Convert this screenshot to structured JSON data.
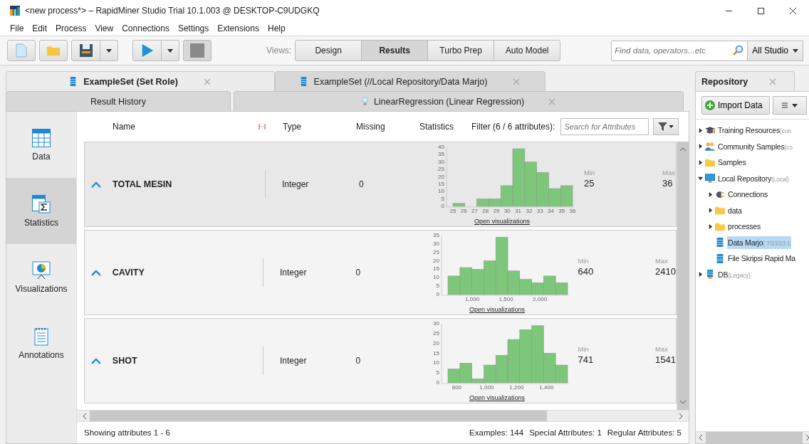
{
  "window": {
    "title": "<new process*> – RapidMiner Studio Trial 10.1.003 @ DESKTOP-C9UDGKQ"
  },
  "menu": [
    {
      "label": "File"
    },
    {
      "label": "Edit"
    },
    {
      "label": "Process"
    },
    {
      "label": "View"
    },
    {
      "label": "Connections"
    },
    {
      "label": "Settings"
    },
    {
      "label": "Extensions"
    },
    {
      "label": "Help"
    }
  ],
  "toolbar": {
    "views_label": "Views:",
    "views": [
      {
        "label": "Design",
        "selected": false
      },
      {
        "label": "Results",
        "selected": true
      },
      {
        "label": "Turbo Prep",
        "selected": false
      },
      {
        "label": "Auto Model",
        "selected": false
      }
    ],
    "search": {
      "placeholder": "Find data, operators...etc"
    },
    "scope": "All Studio"
  },
  "result_tabs": [
    {
      "label": "ExampleSet (Set Role)",
      "selected": true
    },
    {
      "label": "ExampleSet (//Local Repository/Data Marjo)",
      "selected": false
    }
  ],
  "result_tabs_2": [
    {
      "label": "Result History",
      "kind": "plain"
    },
    {
      "label": "LinearRegression (Linear Regression)",
      "kind": "model"
    }
  ],
  "side_nav": [
    {
      "label": "Data",
      "selected": false
    },
    {
      "label": "Statistics",
      "selected": true
    },
    {
      "label": "Visualizations",
      "selected": false
    },
    {
      "label": "Annotations",
      "selected": false
    }
  ],
  "columns": {
    "name": "Name",
    "type": "Type",
    "missing": "Missing",
    "statistics": "Statistics",
    "filter": "Filter (6 / 6 attributes):",
    "search_placeholder": "Search for Attributes"
  },
  "attributes": [
    {
      "name": "TOTAL MESIN",
      "type": "Integer",
      "missing": "0",
      "min_label": "Min",
      "min": "25",
      "max_label": "Max",
      "max": "36",
      "link": "Open visualizations",
      "chart_data": {
        "type": "bar",
        "x": [
          25.55,
          26.65,
          27.75,
          28.85,
          29.95,
          31.05,
          32.15,
          33.25,
          34.35,
          35.45
        ],
        "values": [
          2,
          0,
          5,
          5,
          14,
          39,
          30,
          23,
          12,
          14
        ],
        "xlim": [
          25,
          36
        ],
        "ylim": [
          0,
          40
        ],
        "xticks": [
          25,
          26,
          27,
          28,
          29,
          30,
          31,
          32,
          33,
          34,
          35,
          36
        ],
        "yticks": [
          0,
          5,
          10,
          15,
          20,
          25,
          30,
          35,
          40
        ]
      }
    },
    {
      "name": "CAVITY",
      "type": "Integer",
      "missing": "0",
      "min_label": "Min",
      "min": "640",
      "max_label": "Max",
      "max": "2410",
      "link": "Open visualizations",
      "chart_data": {
        "type": "bar",
        "x": [
          728.5,
          905.5,
          1082.5,
          1259.5,
          1436.5,
          1613.5,
          1790.5,
          1967.5,
          2144.5,
          2321.5
        ],
        "values": [
          11,
          16,
          15,
          20,
          34,
          14,
          9,
          7,
          11,
          7
        ],
        "xlim": [
          640,
          2410
        ],
        "ylim": [
          0,
          35
        ],
        "xticks": [
          {
            "value": 1000,
            "label": "1,000"
          },
          {
            "value": 1500,
            "label": "1,500"
          },
          {
            "value": 2000,
            "label": "2,000"
          }
        ],
        "yticks": [
          0,
          5,
          10,
          15,
          20,
          25,
          30,
          35
        ]
      }
    },
    {
      "name": "SHOT",
      "type": "Integer",
      "missing": "0",
      "min_label": "Min",
      "min": "741",
      "max_label": "Max",
      "max": "1541",
      "link": "Open visualizations",
      "chart_data": {
        "type": "bar",
        "x": [
          781,
          861,
          941,
          1021,
          1101,
          1181,
          1261,
          1341,
          1421,
          1501
        ],
        "values": [
          7,
          10,
          2,
          9,
          14,
          22,
          27,
          29,
          15,
          9
        ],
        "xlim": [
          741,
          1541
        ],
        "ylim": [
          0,
          30
        ],
        "xticks": [
          800,
          {
            "value": 1000,
            "label": "1,000"
          },
          {
            "value": 1200,
            "label": "1,200"
          },
          {
            "value": 1400,
            "label": "1,400"
          }
        ],
        "yticks": [
          0,
          5,
          10,
          15,
          20,
          25,
          30
        ]
      }
    }
  ],
  "status": {
    "showing": "Showing attributes 1 - 6",
    "examples": "Examples: 144",
    "special": "Special Attributes: 1",
    "regular": "Regular Attributes: 5"
  },
  "repository": {
    "title": "Repository",
    "import": "Import Data",
    "items": [
      {
        "label": "Training Resources",
        "note": "(con",
        "kind": "training",
        "expanded": false,
        "selected": false
      },
      {
        "label": "Community Samples",
        "note": "(co",
        "kind": "community",
        "expanded": false,
        "selected": false
      },
      {
        "label": "Samples",
        "kind": "folder",
        "expanded": false,
        "selected": false
      },
      {
        "label": "Local Repository",
        "note": "(Local)",
        "kind": "repository",
        "expanded": true,
        "selected": false,
        "children": [
          {
            "label": "Connections",
            "kind": "connections",
            "expanded": false,
            "selected": false
          },
          {
            "label": "data",
            "kind": "folder",
            "expanded": false,
            "selected": false
          },
          {
            "label": "processes",
            "kind": "folder",
            "expanded": false,
            "selected": false
          },
          {
            "label": "Data Marjo",
            "note": "( 7/23/23 1",
            "kind": "dataset",
            "selected": true
          },
          {
            "label": "File Skripsi Rapid Ma",
            "kind": "dataset",
            "selected": false
          }
        ]
      },
      {
        "label": "DB",
        "note": "(Legacy)",
        "kind": "database",
        "expanded": false,
        "selected": false
      }
    ]
  }
}
